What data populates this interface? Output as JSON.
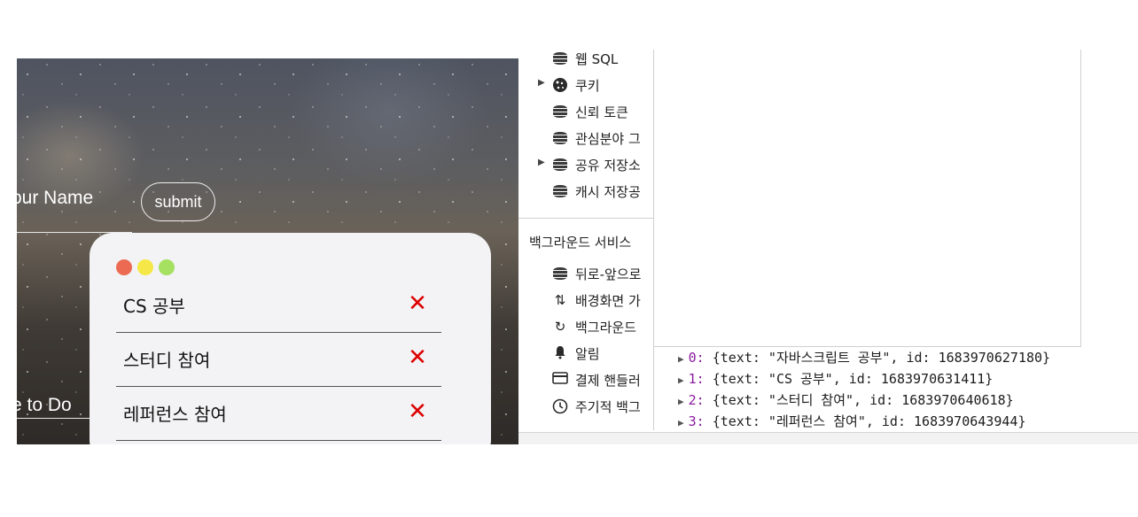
{
  "app": {
    "name_label": "our Name",
    "submit_label": "submit",
    "todo_label": "e to Do",
    "dot_colors": [
      "#ec6a52",
      "#f5e846",
      "#a5e060"
    ],
    "todos": [
      {
        "text": "CS 공부",
        "delete_icon": "✕"
      },
      {
        "text": "스터디 참여",
        "delete_icon": "✕"
      },
      {
        "text": "레퍼런스 참여",
        "delete_icon": "✕"
      }
    ]
  },
  "devtools": {
    "storage_items": [
      {
        "label": "웹 SQL",
        "icon": "database-icon",
        "arrow": ""
      },
      {
        "label": "쿠키",
        "icon": "cookie-icon",
        "arrow": "▶"
      },
      {
        "label": "신뢰 토큰",
        "icon": "database-icon",
        "arrow": ""
      },
      {
        "label": "관심분야 그",
        "icon": "database-icon",
        "arrow": ""
      },
      {
        "label": "공유 저장소",
        "icon": "database-icon",
        "arrow": "▶"
      },
      {
        "label": "캐시 저장공",
        "icon": "database-icon",
        "arrow": ""
      }
    ],
    "background_header": "백그라운드 서비스",
    "background_items": [
      {
        "label": "뒤로-앞으로",
        "icon": "database-icon",
        "glyph": ""
      },
      {
        "label": "배경화면 가",
        "icon": "sort-arrows-icon",
        "glyph": "⇅"
      },
      {
        "label": "백그라운드",
        "icon": "sync-icon",
        "glyph": "↻"
      },
      {
        "label": "알림",
        "icon": "bell-icon",
        "glyph": "🔔"
      },
      {
        "label": "결제 핸들러",
        "icon": "card-icon",
        "glyph": "▭"
      },
      {
        "label": "주기적 백그",
        "icon": "clock-icon",
        "glyph": "◷"
      }
    ],
    "console_rows": [
      {
        "index": "0",
        "text": "자바스크립트 공부",
        "id": "1683970627180"
      },
      {
        "index": "1",
        "text": "CS 공부",
        "id": "1683970631411"
      },
      {
        "index": "2",
        "text": "스터디 참여",
        "id": "1683970640618"
      },
      {
        "index": "3",
        "text": "레퍼런스 참여",
        "id": "1683970643944"
      }
    ]
  }
}
